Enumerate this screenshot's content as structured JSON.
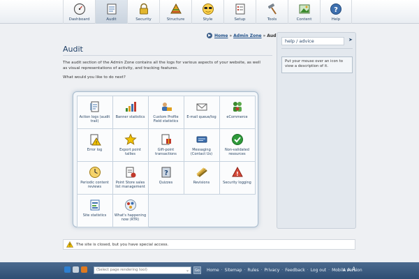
{
  "nav": {
    "tabs": [
      {
        "label": "Dashboard",
        "icon": "dashboard-gauge-icon",
        "active": false
      },
      {
        "label": "Audit",
        "icon": "audit-document-icon",
        "active": true
      },
      {
        "label": "Security",
        "icon": "padlock-icon",
        "active": false
      },
      {
        "label": "Structure",
        "icon": "pyramid-icon",
        "active": false
      },
      {
        "label": "Style",
        "icon": "sunglasses-face-icon",
        "active": false
      },
      {
        "label": "Setup",
        "icon": "setup-form-icon",
        "active": false
      },
      {
        "label": "Tools",
        "icon": "hammer-icon",
        "active": false
      },
      {
        "label": "Content",
        "icon": "content-picture-icon",
        "active": false
      },
      {
        "label": "Help",
        "icon": "question-mark-icon",
        "active": false
      }
    ]
  },
  "breadcrumb": {
    "home": "Home",
    "admin_zone": "Admin Zone",
    "current": "Audit",
    "separator": "»"
  },
  "page": {
    "title": "Audit",
    "intro": "The audit section of the Admin Zone contains all the logs for various aspects of your website, as well as visual representations of activity, and tracking features.",
    "prompt": "What would you like to do next?"
  },
  "grid": {
    "items": [
      {
        "label": "Action logs (audit trail)",
        "icon": "action-logs-icon"
      },
      {
        "label": "Banner statistics",
        "icon": "banner-statistics-icon"
      },
      {
        "label": "Custom Profile Field statistics",
        "icon": "profile-field-icon"
      },
      {
        "label": "E-mail queue/log",
        "icon": "email-envelope-icon"
      },
      {
        "label": "eCommerce",
        "icon": "ecommerce-people-icon"
      },
      {
        "label": "Error log",
        "icon": "error-log-icon"
      },
      {
        "label": "Export point tallies",
        "icon": "star-icon"
      },
      {
        "label": "Gift-point transactions",
        "icon": "gift-points-icon"
      },
      {
        "label": "Messaging (Contact Us)",
        "icon": "messaging-icon"
      },
      {
        "label": "Non-validated resources",
        "icon": "checkmark-circle-icon"
      },
      {
        "label": "Periodic content reviews",
        "icon": "clock-icon"
      },
      {
        "label": "Point Store sales list management",
        "icon": "point-store-icon"
      },
      {
        "label": "Quizzes",
        "icon": "quiz-icon"
      },
      {
        "label": "Revisions",
        "icon": "revisions-icon"
      },
      {
        "label": "Security logging",
        "icon": "security-logging-icon"
      },
      {
        "label": "Site statistics",
        "icon": "site-statistics-icon"
      },
      {
        "label": "What's happening now (RTR)",
        "icon": "realtime-rain-icon"
      }
    ]
  },
  "help": {
    "header": "help / advice",
    "arrow": "➤",
    "text": "Put your mouse over an icon to view a description of it."
  },
  "notice": {
    "text": "The site is closed, but you have special access.",
    "icon": "warning-icon"
  },
  "footer": {
    "select_placeholder": "(Select page rendering tool)",
    "go_label": "Go",
    "links": [
      "Home",
      "Sitemap",
      "Rules",
      "Privacy",
      "Feedback",
      "Log out",
      "Mobile version"
    ],
    "link_separator": "·",
    "font_sizer": [
      "A",
      "A",
      "A"
    ]
  },
  "colors": {
    "accent": "#1f4f88",
    "footer": "#3a5a7f",
    "notice_warning": "#f2c200"
  }
}
